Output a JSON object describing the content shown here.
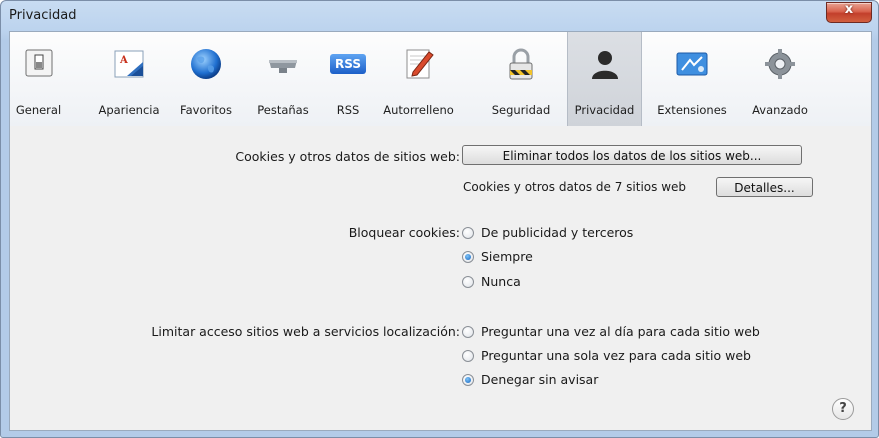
{
  "window": {
    "title": "Privacidad",
    "close_glyph": "x"
  },
  "toolbar": {
    "items": [
      {
        "label": "General",
        "icon": "general-switch-icon"
      },
      {
        "label": "Apariencia",
        "icon": "appearance-icon"
      },
      {
        "label": "Favoritos",
        "icon": "globe-icon"
      },
      {
        "label": "Pestañas",
        "icon": "tabs-icon"
      },
      {
        "label": "RSS",
        "icon": "rss-icon",
        "badge": "RSS"
      },
      {
        "label": "Autorrelleno",
        "icon": "autofill-pencil-icon"
      },
      {
        "label": "Seguridad",
        "icon": "padlock-icon"
      },
      {
        "label": "Privacidad",
        "icon": "person-silhouette-icon",
        "selected": true
      },
      {
        "label": "Extensiones",
        "icon": "extensions-icon"
      },
      {
        "label": "Avanzado",
        "icon": "gear-icon"
      }
    ]
  },
  "privacy": {
    "cookies_label": "Cookies y otros datos de sitios web:",
    "remove_all_button": "Eliminar todos los datos de los sitios web...",
    "cookies_count_text": "Cookies y otros datos de 7 sitios web",
    "details_button": "Detalles...",
    "block_cookies_label": "Bloquear cookies:",
    "block_options": [
      {
        "label": "De publicidad y terceros",
        "selected": false
      },
      {
        "label": "Siempre",
        "selected": true
      },
      {
        "label": "Nunca",
        "selected": false
      }
    ],
    "location_label": "Limitar acceso sitios web a servicios localización:",
    "location_options": [
      {
        "label": "Preguntar una vez al día para cada sitio web",
        "selected": false
      },
      {
        "label": "Preguntar una sola vez para cada sitio web",
        "selected": false
      },
      {
        "label": "Denegar sin avisar",
        "selected": true
      }
    ]
  },
  "help": {
    "glyph": "?"
  },
  "colors": {
    "radio_selected": "#1565c0",
    "close_button": "#c94a35",
    "frame": "#bcd3ee"
  }
}
